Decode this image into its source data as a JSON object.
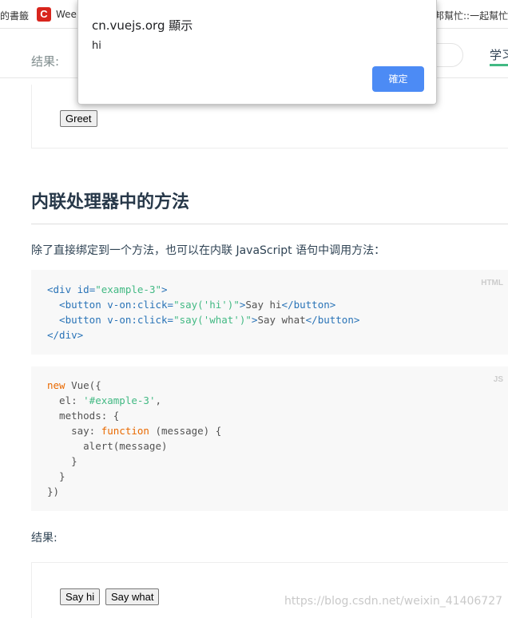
{
  "bookmarks": {
    "left_fragment": "的書籤",
    "logo_letter": "C",
    "wee": "Wee",
    "right_fragment": "邦幫忙::一起幫忙..."
  },
  "header": {
    "result_label": "结果:",
    "learn_label": "学习"
  },
  "demo1": {
    "greet_label": "Greet"
  },
  "section": {
    "heading": "内联处理器中的方法",
    "intro": "除了直接绑定到一个方法，也可以在内联 JavaScript 语句中调用方法："
  },
  "code_html": {
    "lang": "HTML",
    "l1a": "<div ",
    "l1b": "id=",
    "l1c": "\"example-3\"",
    "l1d": ">",
    "l2a": "  <button ",
    "l2b": "v-on:click=",
    "l2c": "\"say('hi')\"",
    "l2d": ">",
    "l2e": "Say hi",
    "l2f": "</button>",
    "l3a": "  <button ",
    "l3b": "v-on:click=",
    "l3c": "\"say('what')\"",
    "l3d": ">",
    "l3e": "Say what",
    "l3f": "</button>",
    "l4": "</div>"
  },
  "code_js": {
    "lang": "JS",
    "l1a": "new",
    "l1b": " Vue({",
    "l2a": "  el: ",
    "l2b": "'#example-3'",
    "l2c": ",",
    "l3": "  methods: {",
    "l4a": "    say: ",
    "l4b": "function",
    "l4c": " (message) {",
    "l5": "      alert(message)",
    "l6": "    }",
    "l7": "  }",
    "l8": "})"
  },
  "result2": {
    "label": "结果:",
    "say_hi_label": "Say hi",
    "say_what_label": "Say what"
  },
  "dialog": {
    "title": "cn.vuejs.org 顯示",
    "message": "hi",
    "ok_label": "確定",
    "ok_color": "#4c8bf5"
  },
  "watermark": "https://blog.csdn.net/weixin_41406727"
}
